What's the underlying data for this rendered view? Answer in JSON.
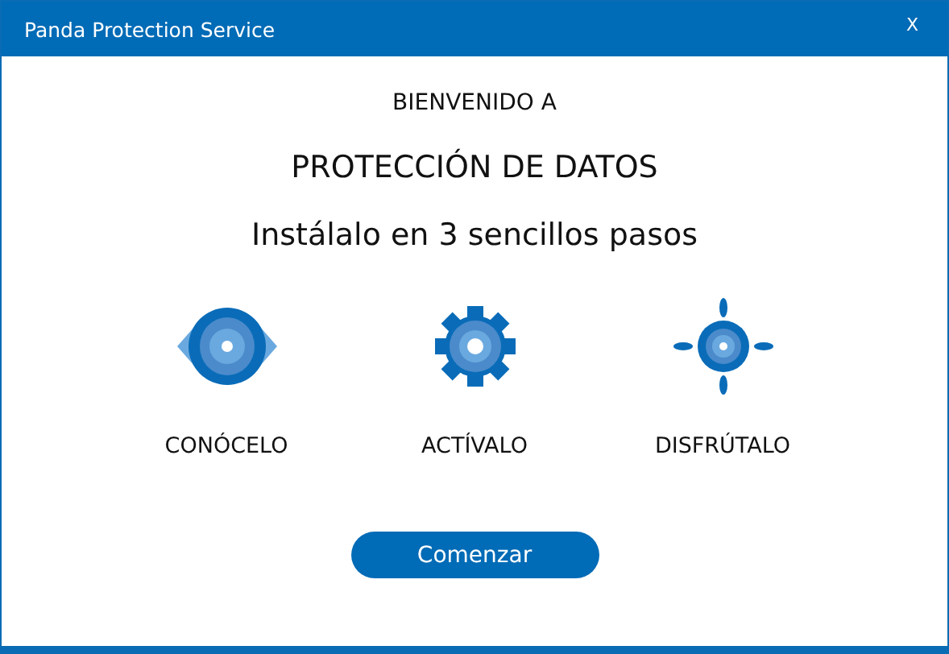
{
  "window": {
    "title": "Panda Protection Service",
    "close": "X"
  },
  "welcome": "BIENVENIDO A",
  "product": "PROTECCIÓN DE DATOS",
  "subtitle": "Instálalo en 3 sencillos pasos",
  "steps": [
    {
      "kind": "eye",
      "label": "CONÓCELO"
    },
    {
      "kind": "gear",
      "label": "ACTÍVALO"
    },
    {
      "kind": "target",
      "label": "DISFRÚTALO"
    }
  ],
  "button": "Comenzar"
}
